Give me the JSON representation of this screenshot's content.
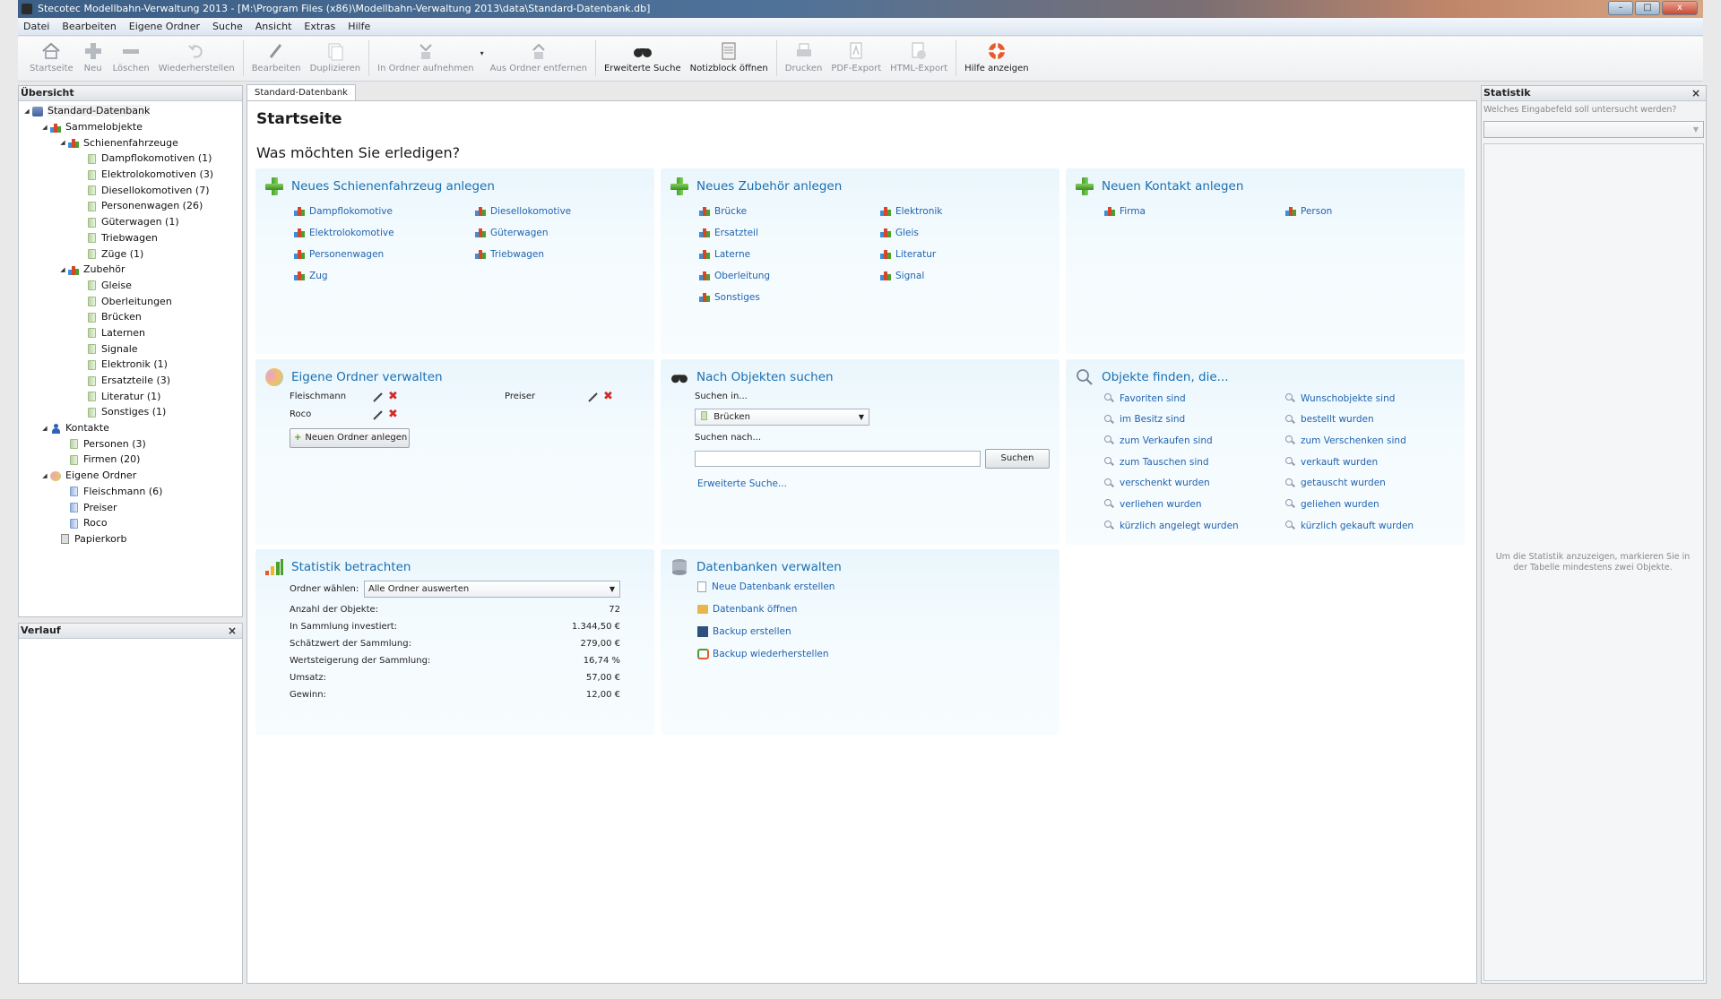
{
  "window": {
    "title": "Stecotec Modellbahn-Verwaltung 2013 - [M:\\Program Files (x86)\\Modellbahn-Verwaltung 2013\\data\\Standard-Datenbank.db]",
    "minimize": "–",
    "maximize": "□",
    "close": "x"
  },
  "menu": [
    "Datei",
    "Bearbeiten",
    "Eigene Ordner",
    "Suche",
    "Ansicht",
    "Extras",
    "Hilfe"
  ],
  "toolbar": {
    "startseite": "Startseite",
    "neu": "Neu",
    "loeschen": "Löschen",
    "wiederherstellen": "Wiederherstellen",
    "bearbeiten": "Bearbeiten",
    "duplizieren": "Duplizieren",
    "in_ordner": "In Ordner aufnehmen",
    "aus_ordner": "Aus Ordner entfernen",
    "erweiterte_suche": "Erweiterte Suche",
    "notizblock": "Notizblock öffnen",
    "drucken": "Drucken",
    "pdf_export": "PDF-Export",
    "html_export": "HTML-Export",
    "hilfe": "Hilfe anzeigen"
  },
  "overview": {
    "header": "Übersicht",
    "tree": {
      "root": "Standard-Datenbank",
      "sammelobjekte": "Sammelobjekte",
      "schienenfahrzeuge": "Schienenfahrzeuge",
      "dampf": "Dampflokomotiven (1)",
      "elektro": "Elektrolokomotiven (3)",
      "diesel": "Diesellokomotiven (7)",
      "personenwagen": "Personenwagen (26)",
      "gueterwagen": "Güterwagen (1)",
      "triebwagen": "Triebwagen",
      "zuege": "Züge (1)",
      "zubehoer": "Zubehör",
      "gleise": "Gleise",
      "oberleitungen": "Oberleitungen",
      "bruecken": "Brücken",
      "laternen": "Laternen",
      "signale": "Signale",
      "elektronik": "Elektronik (1)",
      "ersatzteile": "Ersatzteile (3)",
      "literatur": "Literatur (1)",
      "sonstiges": "Sonstiges (1)",
      "kontakte": "Kontakte",
      "personen": "Personen (3)",
      "firmen": "Firmen (20)",
      "eigene_ordner": "Eigene Ordner",
      "fleischmann": "Fleischmann (6)",
      "preiser": "Preiser",
      "roco": "Roco",
      "papierkorb": "Papierkorb"
    }
  },
  "history": {
    "header": "Verlauf",
    "close": "×"
  },
  "tab": {
    "label": "Standard-Datenbank"
  },
  "start": {
    "title": "Startseite",
    "question": "Was möchten Sie erledigen?",
    "card_fahrzeug": {
      "title": "Neues Schienenfahrzeug anlegen",
      "links": [
        "Dampflokomotive",
        "Diesellokomotive",
        "Elektrolokomotive",
        "Güterwagen",
        "Personenwagen",
        "Triebwagen",
        "Zug"
      ]
    },
    "card_zubehoer": {
      "title": "Neues Zubehör anlegen",
      "links": [
        "Brücke",
        "Elektronik",
        "Ersatzteil",
        "Gleis",
        "Laterne",
        "Literatur",
        "Oberleitung",
        "Signal",
        "Sonstiges"
      ]
    },
    "card_kontakt": {
      "title": "Neuen Kontakt anlegen",
      "links": [
        "Firma",
        "Person"
      ]
    },
    "card_ordner": {
      "title": "Eigene Ordner verwalten",
      "folders": [
        "Fleischmann",
        "Preiser",
        "Roco"
      ],
      "new_button": "Neuen Ordner anlegen"
    },
    "card_suche": {
      "title": "Nach Objekten suchen",
      "search_in_label": "Suchen in...",
      "search_in_value": "Brücken",
      "search_for_label": "Suchen nach...",
      "search_value": "",
      "search_button": "Suchen",
      "advanced": "Erweiterte Suche..."
    },
    "card_finden": {
      "title": "Objekte finden, die...",
      "links": [
        "Favoriten sind",
        "Wunschobjekte sind",
        "im Besitz sind",
        "bestellt wurden",
        "zum Verkaufen sind",
        "zum Verschenken sind",
        "zum Tauschen sind",
        "verkauft wurden",
        "verschenkt wurden",
        "getauscht wurden",
        "verliehen wurden",
        "geliehen wurden",
        "kürzlich angelegt wurden",
        "kürzlich gekauft wurden"
      ]
    },
    "card_statistik": {
      "title": "Statistik betrachten",
      "folder_label": "Ordner wählen:",
      "folder_value": "Alle Ordner auswerten",
      "rows": [
        {
          "label": "Anzahl der Objekte:",
          "value": "72"
        },
        {
          "label": "In Sammlung investiert:",
          "value": "1.344,50 €"
        },
        {
          "label": "Schätzwert der Sammlung:",
          "value": "279,00 €"
        },
        {
          "label": "Wertsteigerung der Sammlung:",
          "value": "16,74 %"
        },
        {
          "label": "Umsatz:",
          "value": "57,00 €"
        },
        {
          "label": "Gewinn:",
          "value": "12,00 €"
        }
      ]
    },
    "card_db": {
      "title": "Datenbanken verwalten",
      "links": [
        "Neue Datenbank erstellen",
        "Datenbank öffnen",
        "Backup erstellen",
        "Backup wiederherstellen"
      ]
    }
  },
  "stats_panel": {
    "header": "Statistik",
    "close": "×",
    "question": "Welches Eingabefeld soll untersucht werden?",
    "select_value": "",
    "hint": "Um die Statistik anzuzeigen, markieren Sie in der Tabelle mindestens zwei Objekte."
  },
  "colors": {
    "link": "#1f63b0",
    "card_title": "#1a6fb0",
    "card_bg": "#eaf6fd",
    "delete": "#d22b2b"
  }
}
